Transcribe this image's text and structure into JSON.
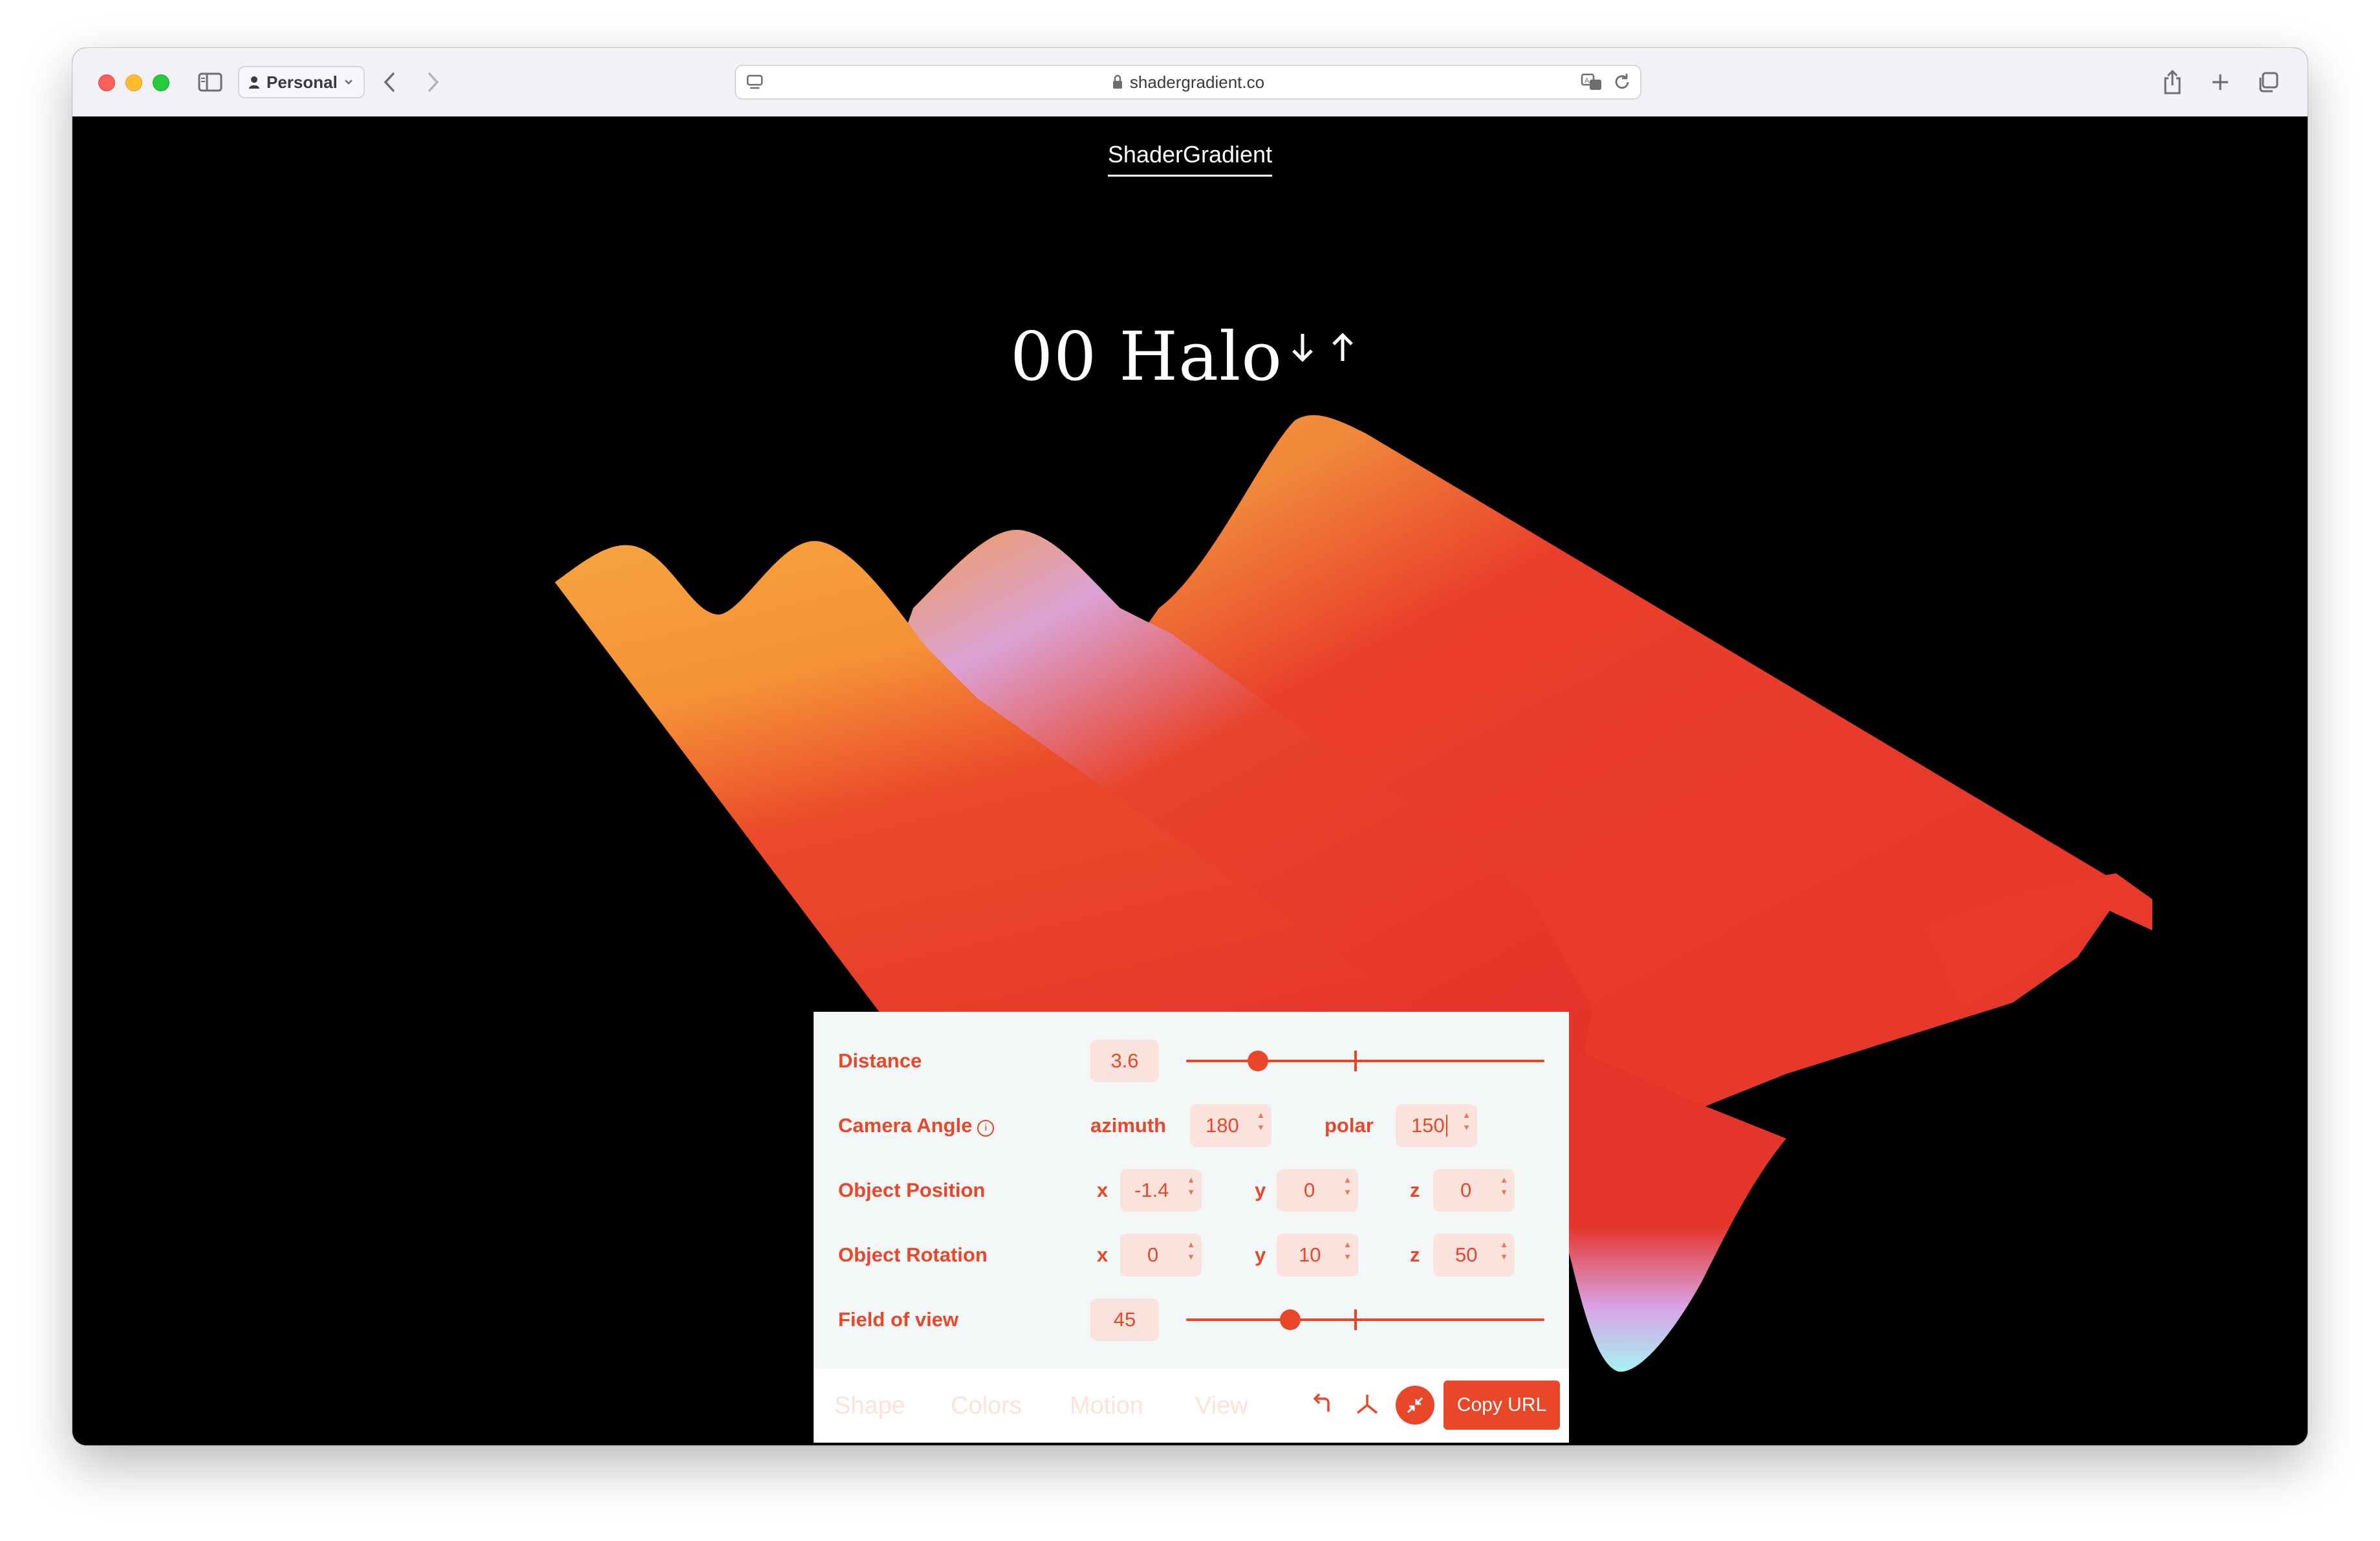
{
  "browser": {
    "profile_label": "Personal",
    "url": "shadergradient.co"
  },
  "page": {
    "brand": "ShaderGradient",
    "preset_title": "00 Halo"
  },
  "panel": {
    "distance": {
      "label": "Distance",
      "value": "3.6",
      "slider_fraction": 0.2
    },
    "camera_angle": {
      "label": "Camera Angle",
      "azimuth_label": "azimuth",
      "azimuth_value": "180",
      "polar_label": "polar",
      "polar_value": "150"
    },
    "object_position": {
      "label": "Object Position",
      "x_label": "x",
      "x_value": "-1.4",
      "y_label": "y",
      "y_value": "0",
      "z_label": "z",
      "z_value": "0"
    },
    "object_rotation": {
      "label": "Object Rotation",
      "x_label": "x",
      "x_value": "0",
      "y_label": "y",
      "y_value": "10",
      "z_label": "z",
      "z_value": "50"
    },
    "field_of_view": {
      "label": "Field of view",
      "value": "45",
      "slider_fraction": 0.29
    },
    "tabs": [
      "Shape",
      "Colors",
      "Motion",
      "View"
    ],
    "copy_button": "Copy URL"
  },
  "colors": {
    "accent": "#e8472a",
    "wave_orange": "#f59a3a",
    "wave_red": "#e8372a",
    "wave_lilac": "#d9a2e6",
    "wave_cyan": "#a6f2f2"
  },
  "icons": [
    "sidebar-icon",
    "person-icon",
    "chevron-down-icon",
    "back-icon",
    "forward-icon",
    "page-icon",
    "lock-icon",
    "translate-icon",
    "reload-icon",
    "share-icon",
    "plus-icon",
    "tabs-icon",
    "arrow-down-icon",
    "arrow-up-icon",
    "undo-icon",
    "axes-icon",
    "collapse-icon"
  ]
}
